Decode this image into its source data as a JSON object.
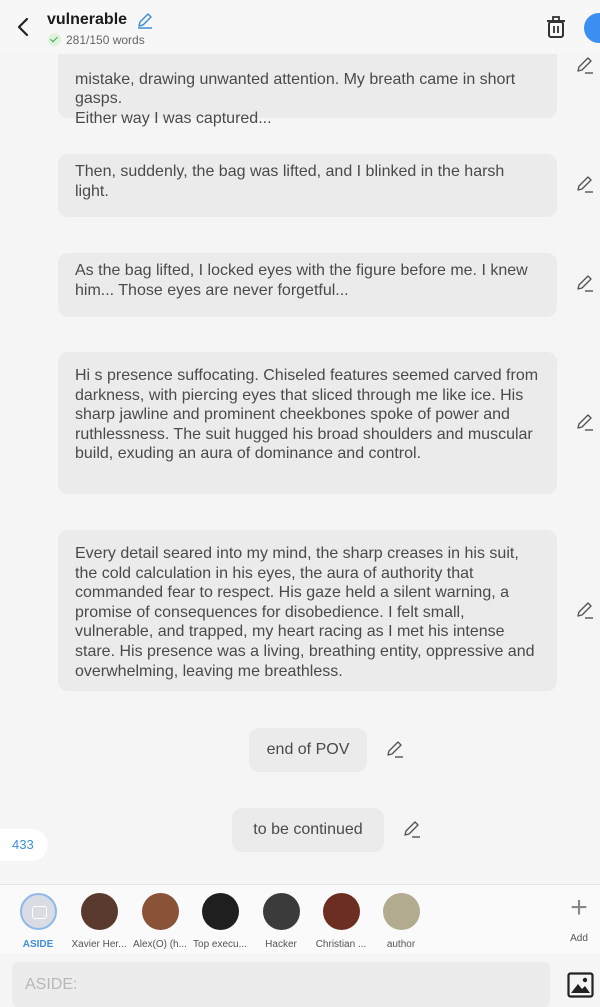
{
  "header": {
    "title": "vulnerable",
    "word_count": "281/150 words"
  },
  "messages": [
    {
      "text": "mistake, drawing unwanted attention. My breath came in short gasps.\nEither way I was captured..."
    },
    {
      "text": "Then, suddenly, the bag was lifted, and I blinked in the harsh light."
    },
    {
      "text": "As the bag lifted, I locked eyes with the figure before me. I knew him... Those eyes are never forgetful..."
    },
    {
      "text": "Hi s presence suffocating. Chiseled features seemed carved from darkness, with piercing eyes that sliced through me like ice. His sharp jawline and prominent cheekbones spoke of power and ruthlessness. The suit hugged his broad shoulders and muscular build, exuding an aura of dominance and control."
    },
    {
      "text": "Every detail seared into my mind, the sharp creases in his suit, the cold calculation in his eyes, the aura of authority that commanded fear to respect. His gaze held a silent warning, a promise of consequences for disobedience. I felt small, vulnerable, and trapped, my heart racing as I met his intense stare. His presence was a living, breathing entity, oppressive and overwhelming, leaving me breathless."
    },
    {
      "text": "end of POV"
    },
    {
      "text": "to be continued"
    }
  ],
  "badge_count": "433",
  "characters": [
    {
      "name": "ASIDE",
      "color": "#d9dde3"
    },
    {
      "name": "Xavier Her...",
      "color": "#5a3a2e"
    },
    {
      "name": "Alex(O) (h...",
      "color": "#8a5236"
    },
    {
      "name": "Top execu...",
      "color": "#1f1f1f"
    },
    {
      "name": "Hacker",
      "color": "#3b3b3b"
    },
    {
      "name": "Christian ...",
      "color": "#6d2e22"
    },
    {
      "name": "author",
      "color": "#b3ab8f"
    }
  ],
  "add_label": "Add",
  "input": {
    "placeholder": "ASIDE:"
  },
  "colors": {
    "accent": "#3f8fd8",
    "bubble": "#ebebeb",
    "background": "#f5f5f5"
  }
}
